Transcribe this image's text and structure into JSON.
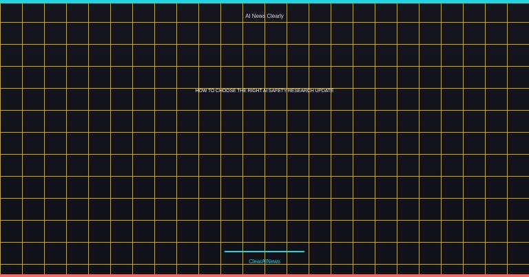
{
  "header": {
    "site_name": "AI News Clearly"
  },
  "main": {
    "headline": "HOW TO CHOOSE THE RIGHT AI SAFETY RESEARCH UPDATE"
  },
  "footer": {
    "brand_label": "ClearAINews"
  },
  "colors": {
    "background": "#12121b",
    "grid": "#e0b70f",
    "accent": "#23d3dd",
    "bottom_bar": "#f26d6a"
  }
}
